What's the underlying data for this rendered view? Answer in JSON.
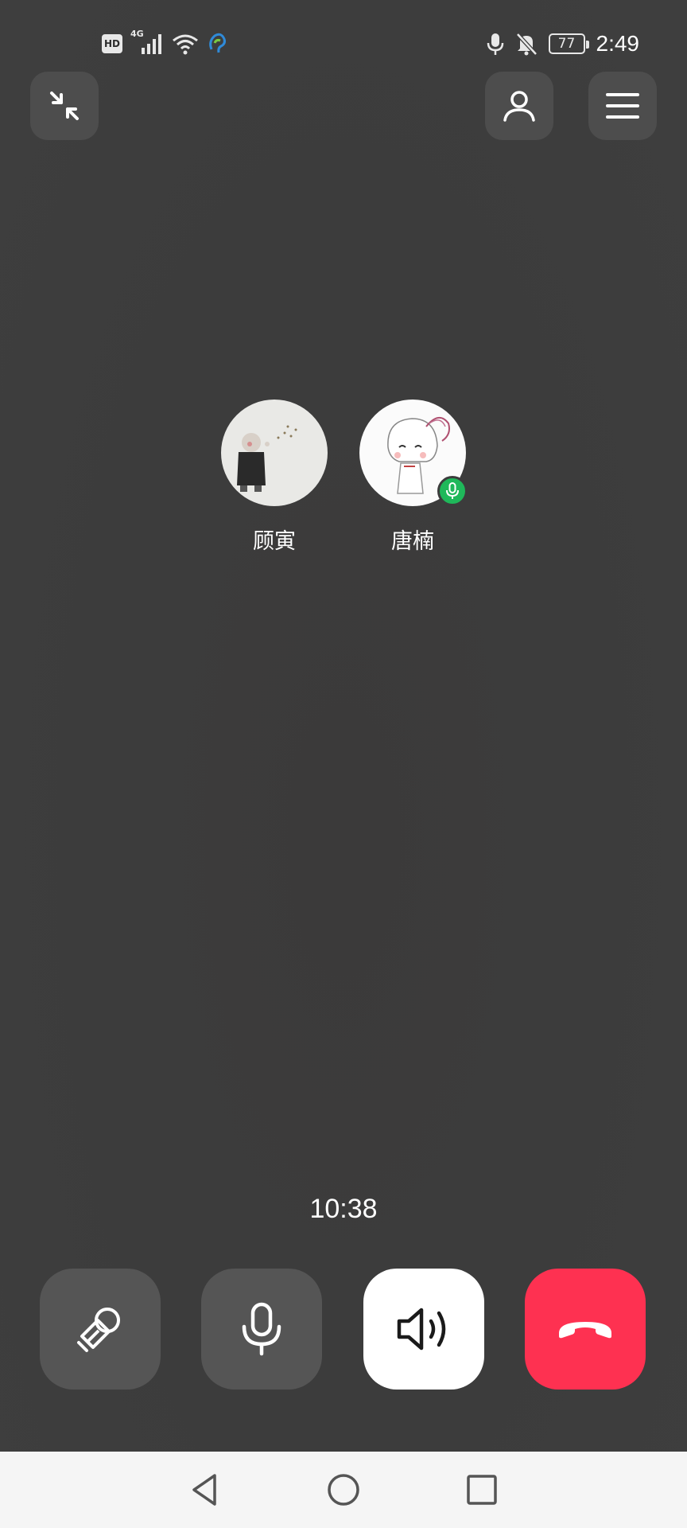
{
  "status_bar": {
    "hd_label": "HD",
    "network_label": "4G",
    "battery_level": "77",
    "time": "2:49"
  },
  "participants": [
    {
      "name": "顾寅",
      "speaking": false
    },
    {
      "name": "唐楠",
      "speaking": true
    }
  ],
  "call": {
    "duration": "10:38"
  },
  "colors": {
    "background": "#3c3c3c",
    "button_gray": "#555555",
    "speaker_active": "#ffffff",
    "hangup_red": "#fe3151",
    "speaking_green": "#1fb85a"
  },
  "icons": {
    "minimize": "minimize-icon",
    "contacts": "person-icon",
    "menu": "menu-icon",
    "effects": "magic-wand-icon",
    "mic": "microphone-icon",
    "speaker": "speaker-icon",
    "hangup": "hang-up-icon"
  }
}
